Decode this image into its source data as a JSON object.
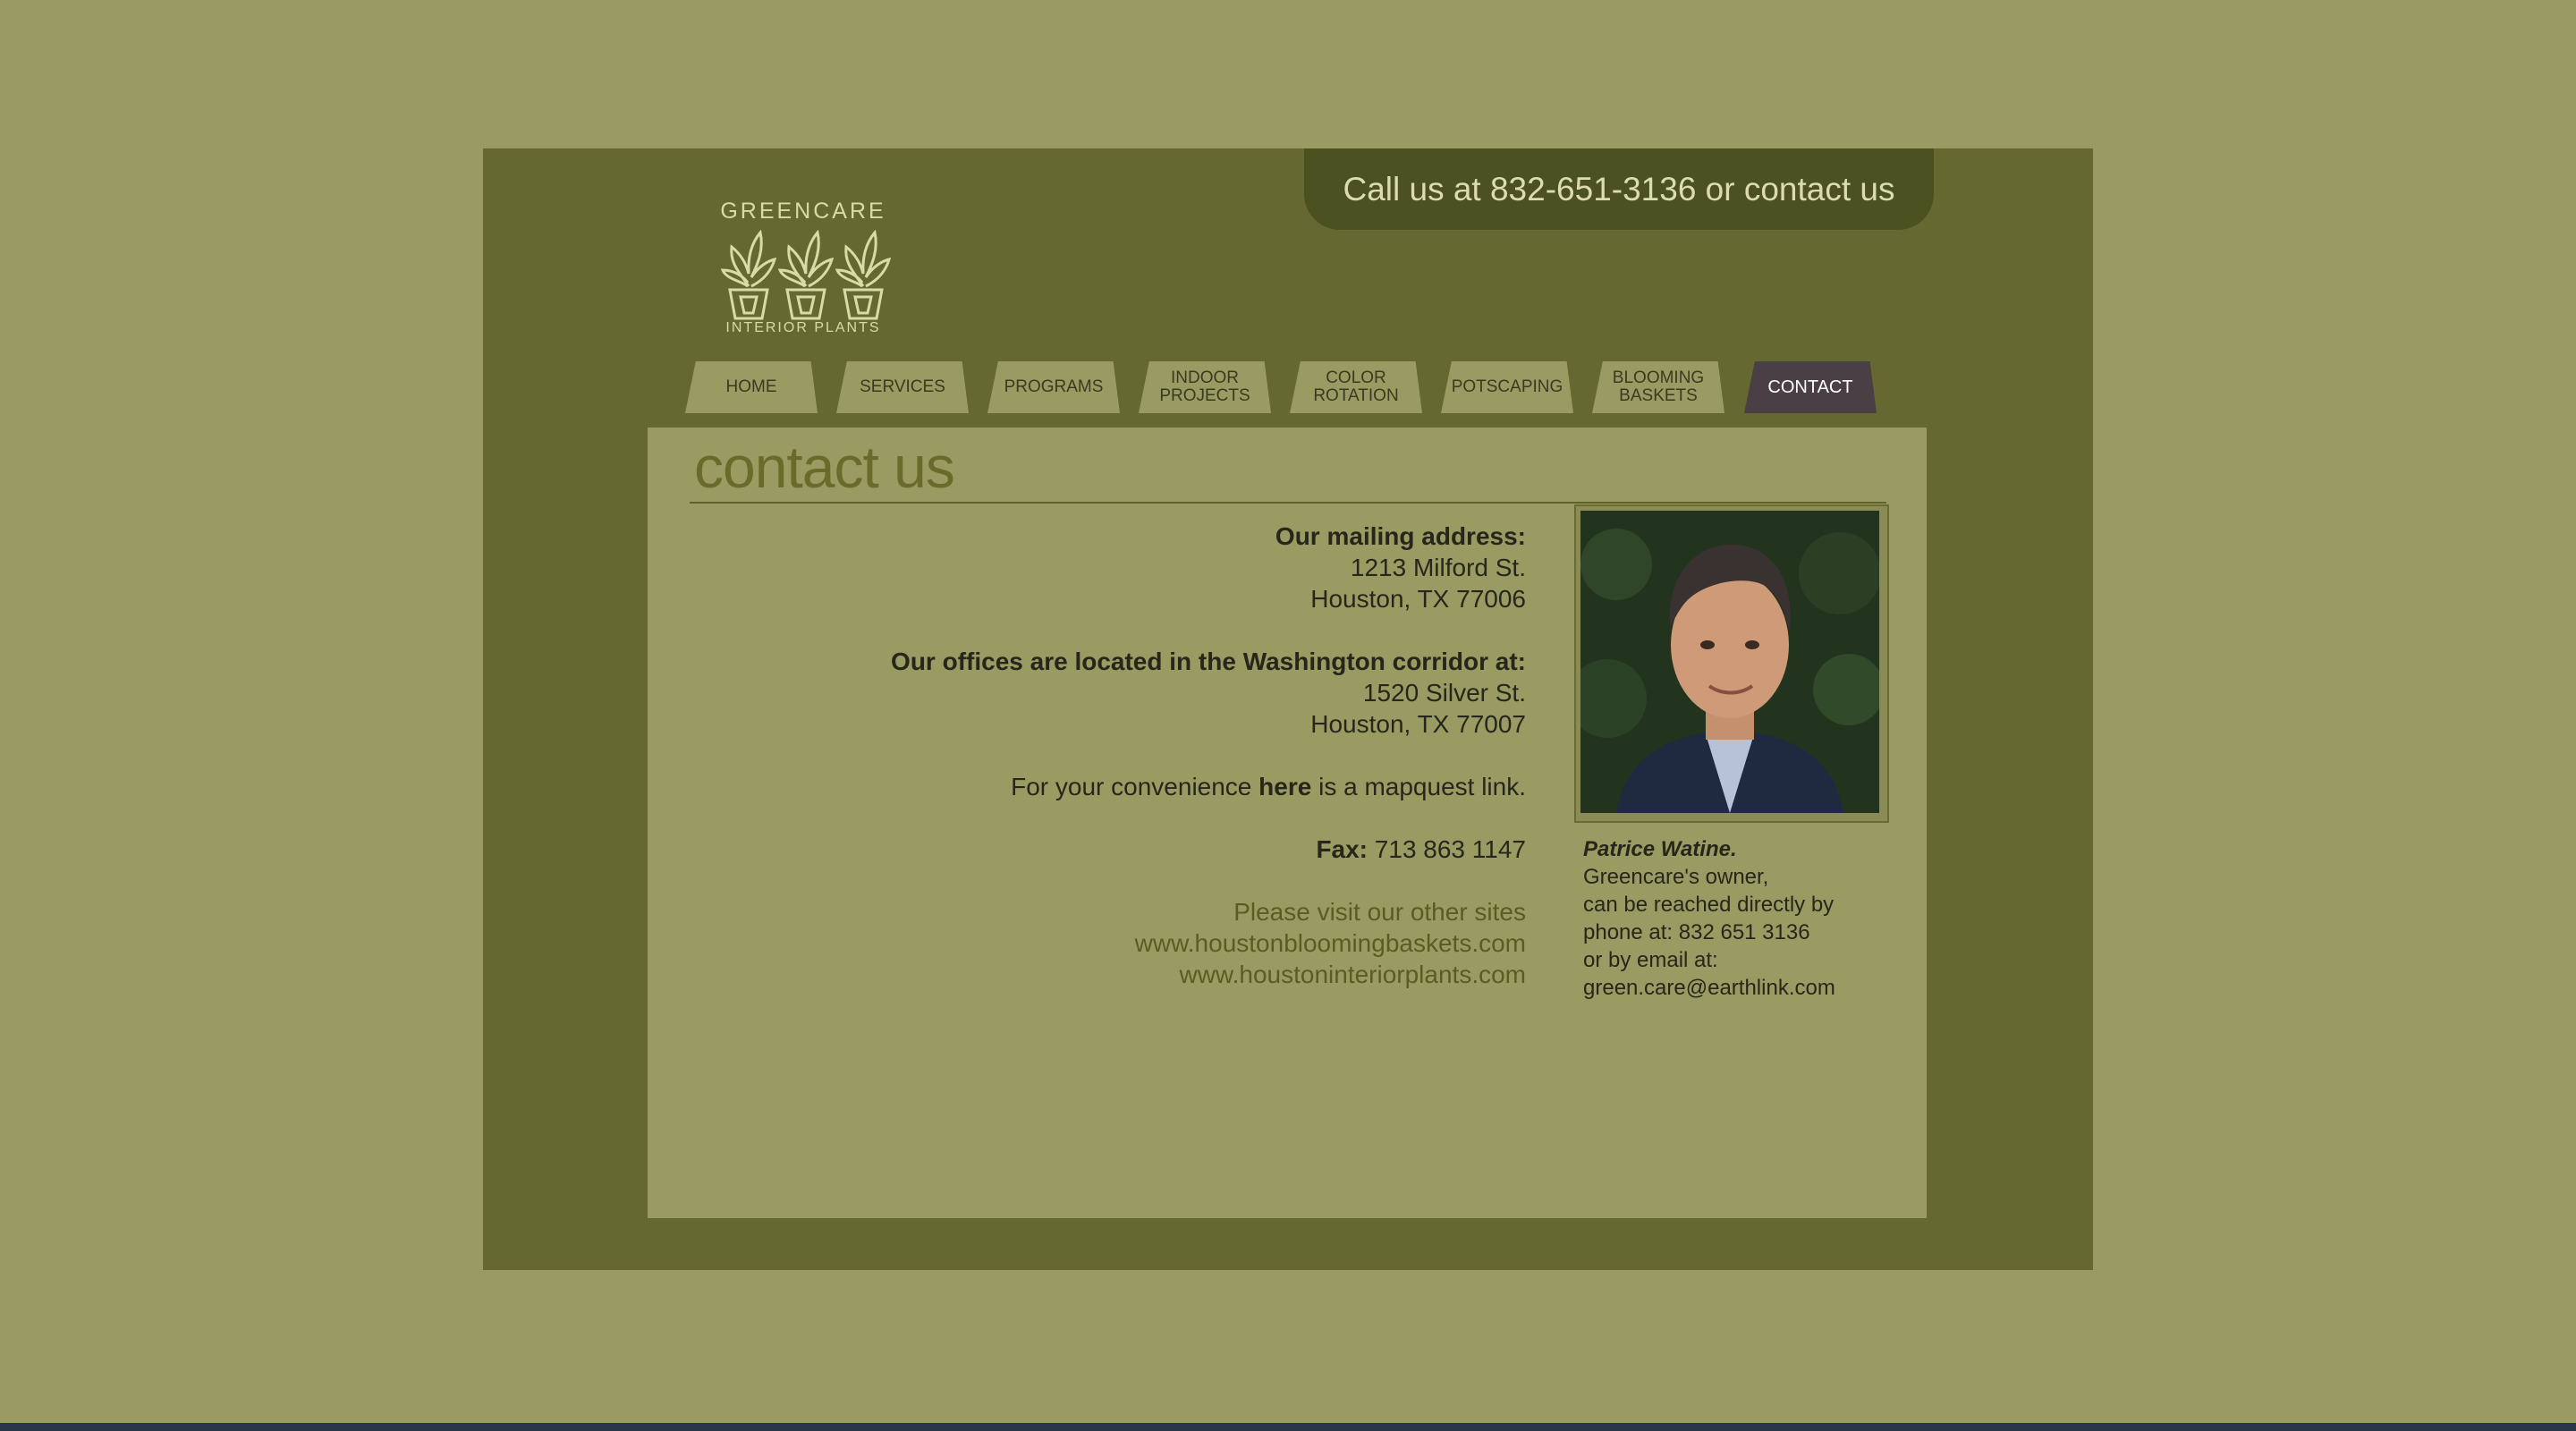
{
  "header": {
    "call_text": "Call us at 832-651-3136 or contact us",
    "logo_brand": "GREENCARE",
    "logo_tagline": "INTERIOR PLANTS"
  },
  "nav": {
    "tabs": [
      {
        "line1": "HOME",
        "line2": ""
      },
      {
        "line1": "SERVICES",
        "line2": ""
      },
      {
        "line1": "PROGRAMS",
        "line2": ""
      },
      {
        "line1": "INDOOR",
        "line2": "PROJECTS"
      },
      {
        "line1": "COLOR",
        "line2": "ROTATION"
      },
      {
        "line1": "POTSCAPING",
        "line2": ""
      },
      {
        "line1": "BLOOMING",
        "line2": "BASKETS"
      },
      {
        "line1": "CONTACT",
        "line2": ""
      }
    ],
    "active": "CONTACT"
  },
  "main": {
    "heading": "contact us",
    "mailing": {
      "label": "Our mailing address:",
      "line1": "1213 Milford St.",
      "line2": "Houston, TX 77006"
    },
    "offices": {
      "label": "Our offices are located in the Washington corridor at:",
      "line1": "1520 Silver St.",
      "line2": "Houston, TX 77007"
    },
    "map": {
      "before": "For your convenience ",
      "link": "here",
      "after": " is a mapquest link."
    },
    "fax": {
      "label": "Fax:",
      "value": " 713 863 1147"
    },
    "other_sites": {
      "intro": "Please visit our other sites",
      "site1": "www.houstonbloomingbaskets.com",
      "site2": "www.houstoninteriorplants.com"
    }
  },
  "owner": {
    "name": "Patrice Watine.",
    "line1": "Greencare's owner,",
    "line2": "can be reached directly by",
    "line3": "phone at: 832 651 3136",
    "line4": "or by email at:",
    "line5": "green.care@earthlink.com"
  },
  "colors": {
    "background": "#9a9b62",
    "frame": "#656830",
    "call_bar": "#4b5120",
    "active_tab": "#4a3f44"
  }
}
